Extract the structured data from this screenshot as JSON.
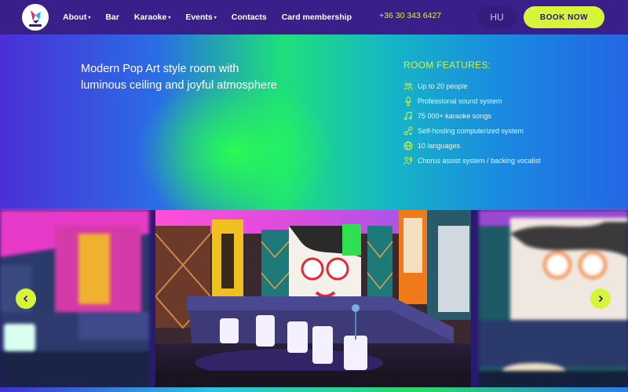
{
  "header": {
    "nav": [
      {
        "label": "About",
        "dropdown": true
      },
      {
        "label": "Bar",
        "dropdown": false
      },
      {
        "label": "Karaoke",
        "dropdown": true
      },
      {
        "label": "Events",
        "dropdown": true
      },
      {
        "label": "Contacts",
        "dropdown": false
      },
      {
        "label": "Card membership",
        "dropdown": false
      }
    ],
    "phone": "+36 30 343 6427",
    "language": "HU",
    "book_label": "BOOK NOW",
    "caret": "▾"
  },
  "hero": {
    "title": "Modern Pop Art style room with luminous ceiling and joyful atmosphere",
    "features_title": "ROOM FEATURES:",
    "features": [
      {
        "icon": "people-icon",
        "label": "Up to 20 people"
      },
      {
        "icon": "microphone-icon",
        "label": "Professional  sound system"
      },
      {
        "icon": "music-note-icon",
        "label": "75 000+ karaoke songs"
      },
      {
        "icon": "network-icon",
        "label": "Self-hosting computerized system"
      },
      {
        "icon": "globe-icon",
        "label": "10 languages"
      },
      {
        "icon": "singer-icon",
        "label": "Chorus assist system / backing vocalist"
      }
    ]
  },
  "colors": {
    "header_bg": "#3a1f8a",
    "accent": "#d6f53a",
    "text": "#ffffff"
  }
}
